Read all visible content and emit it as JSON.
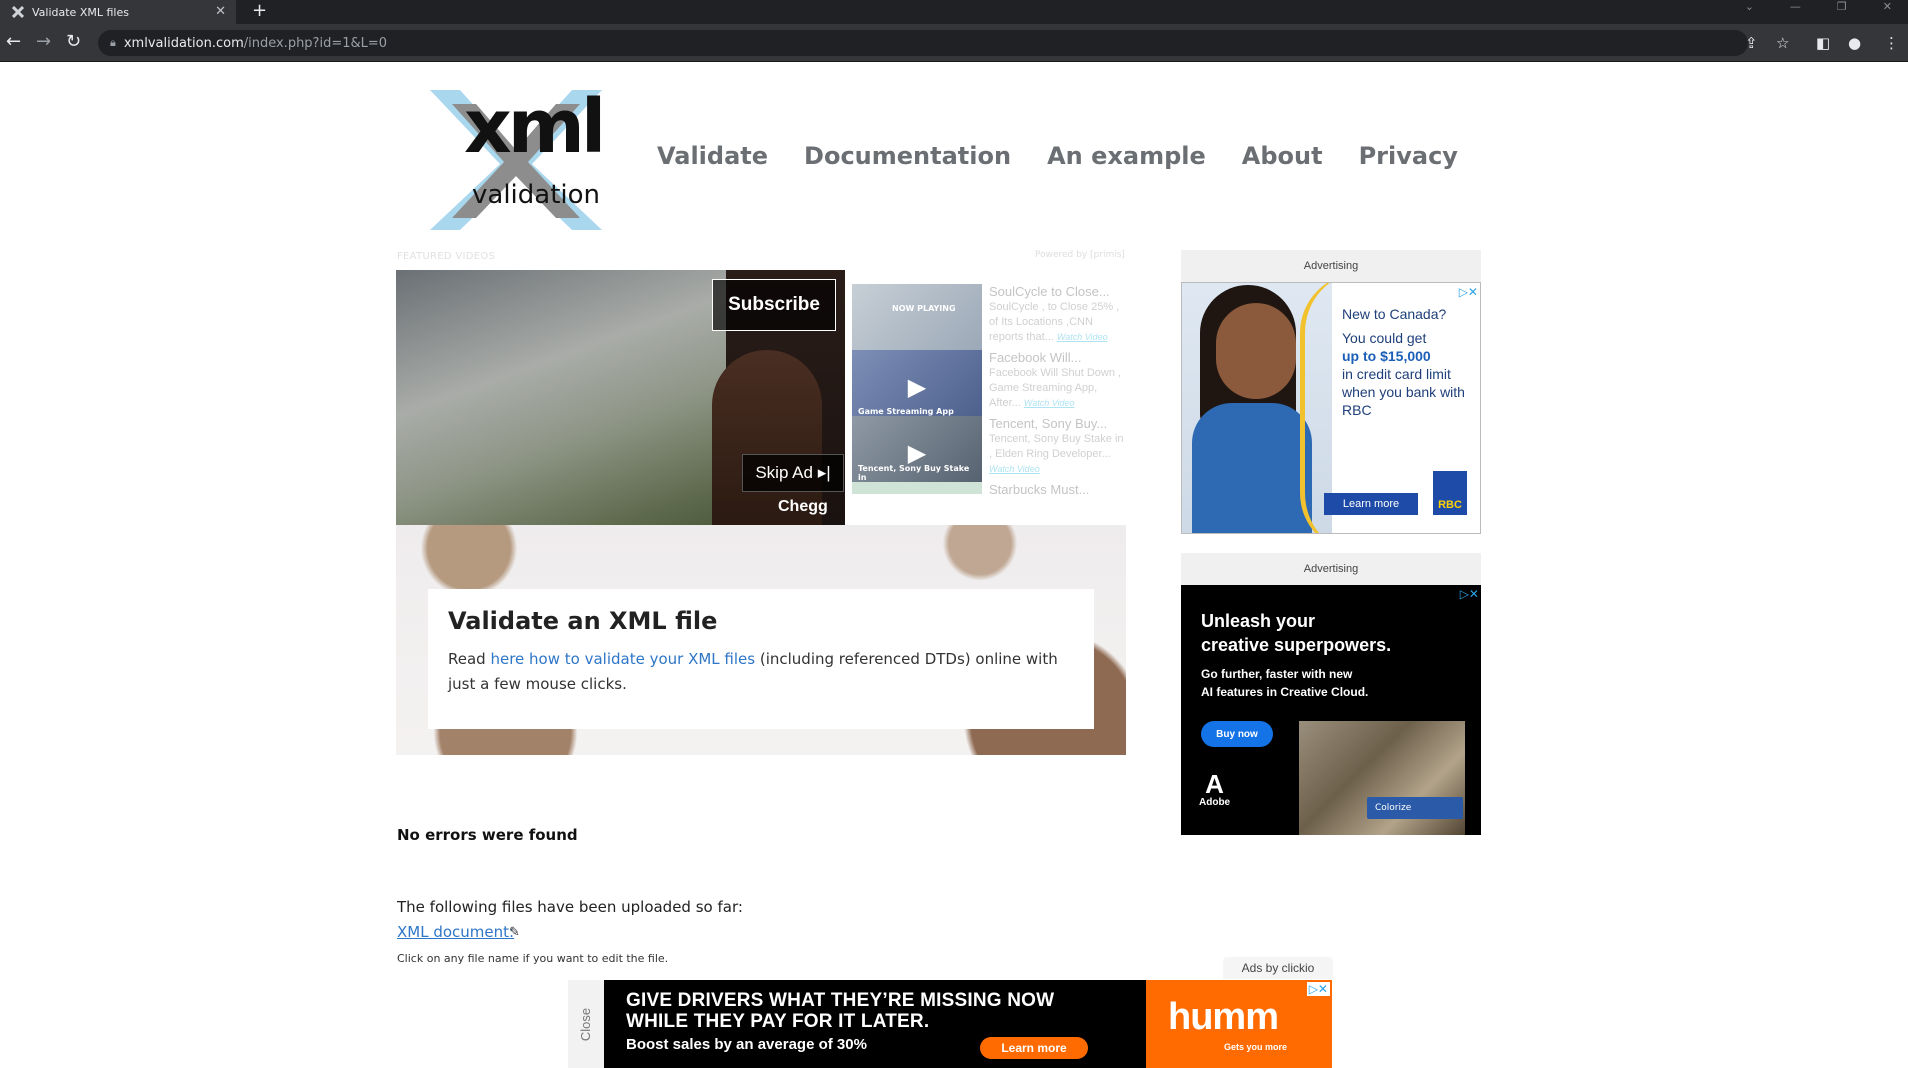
{
  "browser": {
    "tab_title": "Validate XML files",
    "url_host": "xmlvalidation.com",
    "url_path": "/index.php?id=1&L=0"
  },
  "site": {
    "logo_big": "xml",
    "logo_small": "validation",
    "nav": [
      "Validate",
      "Documentation",
      "An example",
      "About",
      "Privacy"
    ]
  },
  "video_widget": {
    "label": "FEATURED VIDEOS",
    "powered": "Powered by [primis]",
    "subscribe": "Subscribe",
    "skip": "Skip Ad ▸|",
    "sponsor": "Chegg",
    "items": [
      {
        "title": "SoulCycle to Close...",
        "desc": "SoulCycle , to Close 25% , of Its Locations ,CNN reports that...",
        "watch": "Watch Video",
        "thumb_caption": "NOW PLAYING"
      },
      {
        "title": "Facebook Will...",
        "desc": "Facebook Will Shut Down , Game Streaming App, After...",
        "watch": "Watch Video",
        "thumb_caption": "Game Streaming App"
      },
      {
        "title": "Tencent, Sony Buy...",
        "desc": "Tencent, Sony Buy Stake in , Elden Ring Developer...",
        "watch": "Watch Video",
        "thumb_caption": "Tencent, Sony Buy Stake in"
      },
      {
        "title": "Starbucks Must...",
        "desc": "",
        "watch": "",
        "thumb_caption": ""
      }
    ]
  },
  "hero": {
    "title": "Validate an XML file",
    "text_before": "Read ",
    "link": "here how to validate your XML files",
    "text_after": " (including referenced DTDs) online with just a few mouse clicks."
  },
  "result": {
    "status": "No errors were found",
    "uploaded_text": "The following files have been uploaded so far:",
    "file_link": "XML document:",
    "hint": "Click on any file name if you want to edit the file."
  },
  "ads": {
    "label": "Advertising",
    "rbc": {
      "headline": "New to Canada?",
      "line1": "You could get",
      "highlight": "up to $15,000",
      "line2": "in credit card limit when you bank with RBC",
      "button": "Learn more",
      "logo": "RBC"
    },
    "adobe": {
      "headline1": "Unleash your",
      "headline2": "creative superpowers.",
      "sub1": "Go further, faster with new",
      "sub2": "AI features in Creative Cloud.",
      "button": "Buy now",
      "logo": "Adobe",
      "colorize": "Colorize"
    },
    "ads_by": "Ads by clickio",
    "bottom": {
      "close": "Close",
      "headline1": "GIVE DRIVERS WHAT THEY’RE MISSING NOW",
      "headline2": "WHILE THEY PAY FOR IT LATER.",
      "sub": "Boost sales by an average of 30%",
      "button": "Learn more",
      "brand": "humm",
      "tagline": "Gets you more"
    }
  }
}
